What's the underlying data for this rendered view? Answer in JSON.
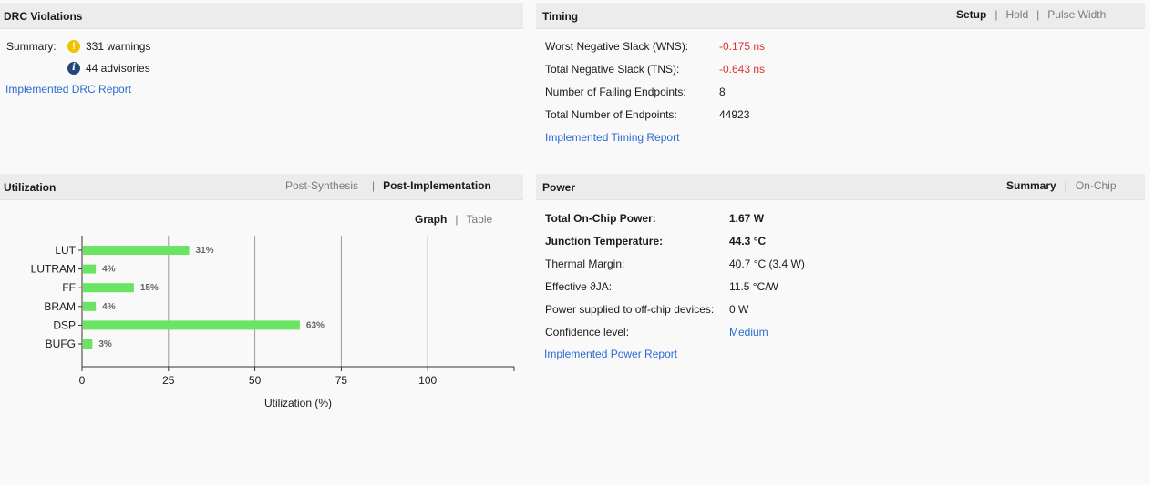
{
  "drc": {
    "title": "DRC Violations",
    "summary_label": "Summary:",
    "warnings": "331 warnings",
    "advisories": "44 advisories",
    "report_link": "Implemented DRC Report"
  },
  "timing": {
    "title": "Timing",
    "tabs": [
      "Setup",
      "Hold",
      "Pulse Width"
    ],
    "rows": [
      {
        "label": "Worst Negative Slack (WNS):",
        "value": "-0.175 ns"
      },
      {
        "label": "Total Negative Slack (TNS):",
        "value": "-0.643 ns"
      },
      {
        "label": "Number of Failing Endpoints:",
        "value": "8"
      },
      {
        "label": "Total Number of Endpoints:",
        "value": "44923"
      }
    ],
    "report_link": "Implemented Timing Report",
    "negative_color": "#d8322e"
  },
  "utilization": {
    "title": "Utilization",
    "tabs": [
      "Post-Synthesis",
      "Post-Implementation"
    ],
    "view_tabs": [
      "Graph",
      "Table"
    ]
  },
  "power": {
    "title": "Power",
    "tabs": [
      "Summary",
      "On-Chip"
    ],
    "rows": [
      {
        "label": "Total On-Chip Power:",
        "value": "1.67 W"
      },
      {
        "label": "Junction Temperature:",
        "value": "44.3 °C"
      },
      {
        "label": "Thermal Margin:",
        "value": "40.7 °C (3.4 W)"
      },
      {
        "label": "Effective ϑJA:",
        "value": "11.5 °C/W"
      },
      {
        "label": "Power supplied to off-chip devices:",
        "value": "0 W"
      },
      {
        "label": "Confidence level:",
        "value": "Medium"
      }
    ],
    "report_link": "Implemented Power Report"
  },
  "colors": {
    "bar": "#6ce463",
    "link": "#2a6bd0",
    "warning": "#f2c200",
    "info": "#23467a"
  },
  "chart_data": {
    "type": "bar",
    "orientation": "horizontal",
    "categories": [
      "LUT",
      "LUTRAM",
      "FF",
      "BRAM",
      "DSP",
      "BUFG"
    ],
    "values": [
      31,
      4,
      15,
      4,
      63,
      3
    ],
    "data_labels": [
      "31%",
      "4%",
      "15%",
      "4%",
      "63%",
      "3%"
    ],
    "xlabel": "Utilization (%)",
    "xticks": [
      0,
      25,
      50,
      75,
      100
    ],
    "xlim": [
      0,
      125
    ],
    "grid": true
  }
}
